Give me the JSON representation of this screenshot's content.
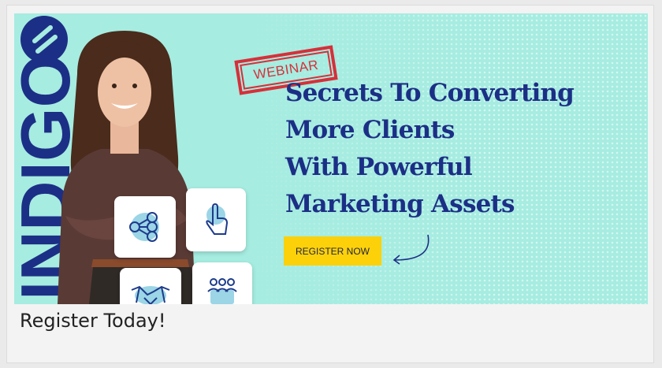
{
  "banner": {
    "logo_text": "INDIGO",
    "stamp_label": "WEBINAR",
    "headline": [
      "Secrets To Converting",
      "More Clients",
      "With Powerful",
      "Marketing Assets"
    ],
    "cta_label": "REGISTER NOW",
    "icons": [
      "people-network-icon",
      "pointer-click-icon",
      "handshake-icon",
      "team-icon"
    ],
    "colors": {
      "background": "#a6ece0",
      "headline": "#1c2f86",
      "stamp": "#d6303a",
      "cta": "#fdd10a"
    }
  },
  "caption": "Register Today!"
}
